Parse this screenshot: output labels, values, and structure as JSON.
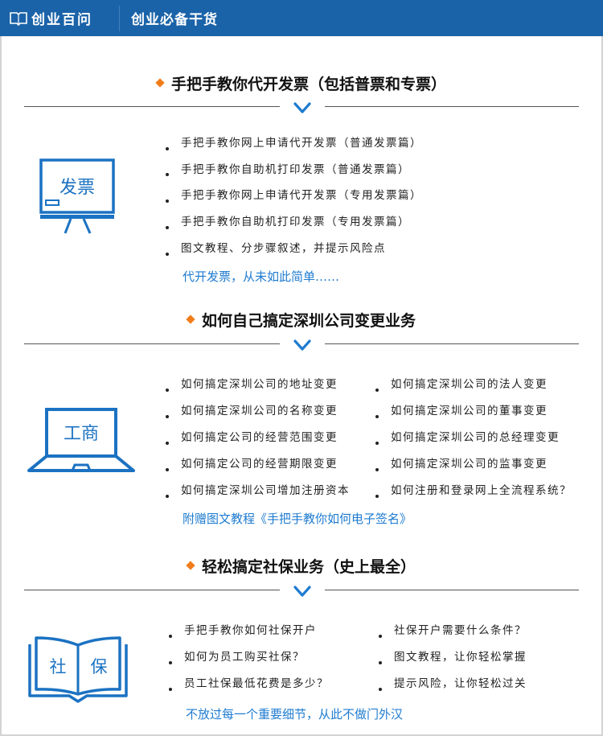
{
  "header": {
    "brand": "创业百问",
    "title": "创业必备干货",
    "brand_icon": "open-book-icon"
  },
  "colors": {
    "header_bg": "#1b63a8",
    "accent_blue": "#1e7bd0",
    "diamond_orange": "#f07d1a"
  },
  "sections": [
    {
      "title": "手把手教你代开发票（包括普票和专票）",
      "icon_label": "发票",
      "icon": "presentation-board-icon",
      "items": [
        "手把手教你网上申请代开发票（普通发票篇）",
        "手把手教你自助机打印发票（普通发票篇）",
        "手把手教你网上申请代开发票（专用发票篇）",
        "手把手教你自助机打印发票（专用发票篇）",
        "图文教程、分步骤叙述，并提示风险点"
      ],
      "note": "代开发票，从未如此简单……"
    },
    {
      "title": "如何自己搞定深圳公司变更业务",
      "icon_label": "工商",
      "icon": "laptop-icon",
      "items_left": [
        "如何搞定深圳公司的地址变更",
        "如何搞定深圳公司的名称变更",
        "如何搞定公司的经营范围变更",
        "如何搞定公司的经营期限变更",
        "如何搞定深圳公司增加注册资本"
      ],
      "items_right": [
        "如何搞定深圳公司的法人变更",
        "如何搞定深圳公司的董事变更",
        "如何搞定深圳公司的总经理变更",
        "如何搞定深圳公司的监事变更",
        "如何注册和登录网上全流程系统？"
      ],
      "note": "附赠图文教程《手把手教你如何电子签名》"
    },
    {
      "title": "轻松搞定社保业务（史上最全）",
      "icon_label_left": "社",
      "icon_label_right": "保",
      "icon": "open-book-icon",
      "items_left": [
        "手把手教你如何社保开户",
        "如何为员工购买社保？",
        "员工社保最低花费是多少？"
      ],
      "items_right": [
        "社保开户需要什么条件？",
        "图文教程，让你轻松掌握",
        "提示风险，让你轻松过关"
      ],
      "note": "不放过每一个重要细节，从此不做门外汉"
    }
  ]
}
